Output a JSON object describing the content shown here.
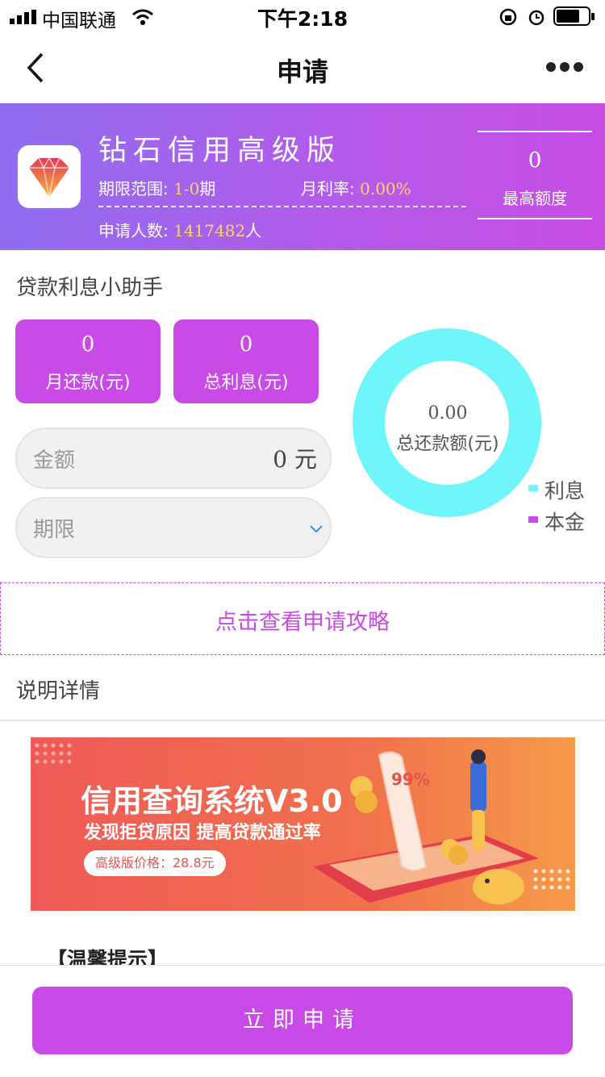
{
  "status_bar": {
    "carrier": "中国联通",
    "time": "下午2:18"
  },
  "nav": {
    "title": "申请"
  },
  "product": {
    "name": "钻石信用高级版",
    "term_label": "期限范围:",
    "term_value": "1-0",
    "term_unit": "期",
    "rate_label": "月利率:",
    "rate_value": "0.00%",
    "applicants_label": "申请人数:",
    "applicants_value": "1417482",
    "applicants_unit": "人",
    "max_value": "0",
    "max_label": "最高额度"
  },
  "calculator": {
    "title": "贷款利息小助手",
    "monthly_value": "0",
    "monthly_label": "月还款(元)",
    "interest_value": "0",
    "interest_label": "总利息(元)",
    "amount_placeholder": "金额",
    "amount_value": "0 元",
    "term_placeholder": "期限",
    "total_value": "0.00",
    "total_label": "总还款额(元)",
    "legend": [
      {
        "label": "利息",
        "color": "#6ff6fb"
      },
      {
        "label": "本金",
        "color": "#c94ae6"
      }
    ]
  },
  "strategy_link": "点击查看申请攻略",
  "details_title": "说明详情",
  "banner": {
    "title": "信用查询系统V3.0",
    "subtitle": "发现拒贷原因 提高贷款通过率",
    "price": "高级版价格：28.8元",
    "percent": "99%"
  },
  "tip_title": "【温馨提示】",
  "apply_button": "立即申请",
  "colors": {
    "accent": "#c94ae6",
    "donut": "#6ff6fb",
    "hero_start": "#8f6df0",
    "hero_end": "#c84ce6"
  }
}
